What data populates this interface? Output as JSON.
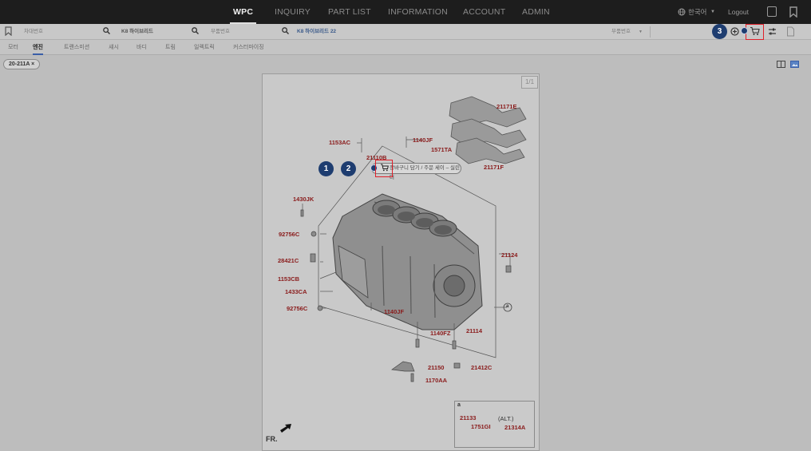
{
  "topnav": {
    "menus": [
      "WPC",
      "INQUIRY",
      "PART LIST",
      "INFORMATION",
      "ACCOUNT",
      "ADMIN"
    ],
    "language": "한국어",
    "logout": "Logout"
  },
  "searchbar": {
    "field1_placeholder": "차대번호",
    "field2_value": "K8 하이브리드",
    "field3_placeholder": "부품번호",
    "field4_value": "K8 하이브리드 22",
    "part_select": "부품번호"
  },
  "tabs": [
    "모터",
    "엔진",
    "트랜스미션",
    "섀시",
    "바디",
    "트림",
    "일렉트릭",
    "커스터마이징"
  ],
  "filter_chip": "20-211A",
  "diagram": {
    "page": "1/1",
    "labels": [
      "21171E",
      "1153AC",
      "1140JF",
      "1571TA",
      "21110B",
      "21171F",
      "1430JK",
      "92756C",
      "28421C",
      "1153CB",
      "1433CA",
      "92756C",
      "21124",
      "1140JF",
      "1140FZ",
      "21114",
      "21150",
      "21412C",
      "1170AA",
      "21133",
      "1751GI",
      "21314A"
    ],
    "inset_tag": "(ALT.)",
    "circle_a": "a",
    "front": "FR."
  },
  "tooltip": "장바구니 담기 / 주문 세이 – 실린더",
  "badges": [
    "1",
    "2",
    "3"
  ],
  "colors": {
    "nav_bg": "#1d1d1d",
    "badge": "#1e3d70",
    "highlight": "#e0202a",
    "label": "#8a1b1b"
  }
}
